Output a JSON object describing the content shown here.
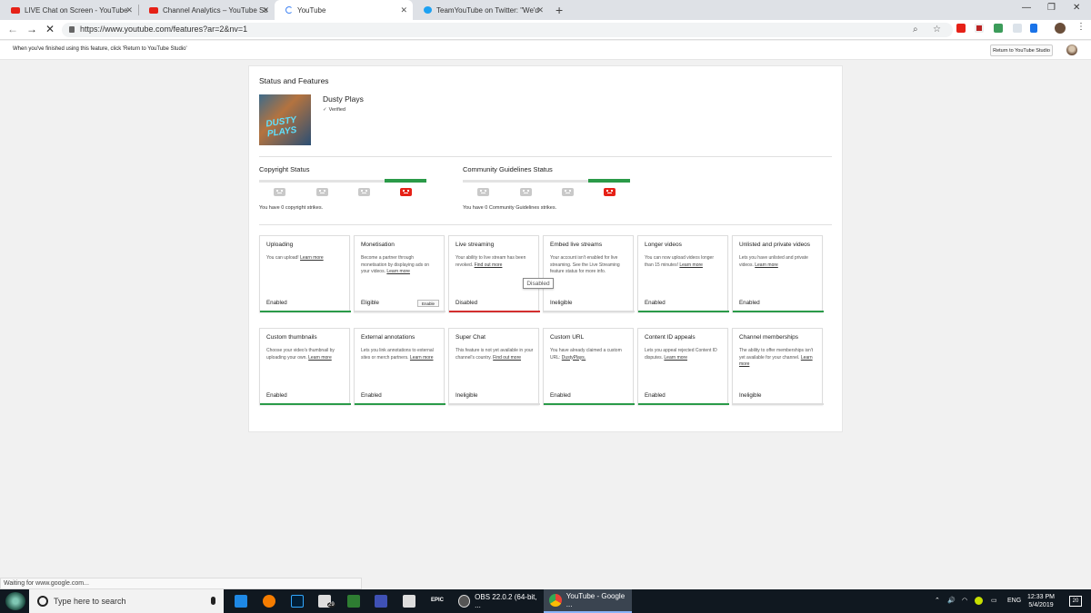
{
  "browser": {
    "tabs": [
      {
        "title": "LIVE Chat on Screen - YouTube L",
        "favicon_color": "#e62117"
      },
      {
        "title": "Channel Analytics – YouTube Stu",
        "favicon_color": "#e62117"
      },
      {
        "title": "YouTube",
        "favicon_color": "#4285f4"
      },
      {
        "title": "TeamYouTube on Twitter: \"We'd",
        "favicon_color": "#1da1f2"
      }
    ],
    "new_tab": "+",
    "url": "https://www.youtube.com/features?ar=2&nv=1",
    "status": "Waiting for www.google.com..."
  },
  "notice": {
    "text": "When you've finished using this feature, click 'Return to YouTube Studio'",
    "return_button": "Return to YouTube Studio"
  },
  "page": {
    "title": "Status and Features",
    "channel": {
      "name": "Dusty Plays",
      "verified": "Verified",
      "thumb_text": "DUSTY PLAYS"
    },
    "copyright": {
      "title": "Copyright Status",
      "text": "You have 0 copyright strikes."
    },
    "community": {
      "title": "Community Guidelines Status",
      "text": "You have 0 Community Guidelines strikes."
    },
    "features": [
      {
        "name": "Uploading",
        "desc": "You can upload!",
        "link": "Learn more",
        "state": "Enabled",
        "color": "#2a9a48"
      },
      {
        "name": "Monetisation",
        "desc": "Become a partner through monetisation by displaying ads on your videos.",
        "link": "Learn more",
        "state": "Eligible",
        "color": "#dddddd",
        "button": "Enable"
      },
      {
        "name": "Live streaming",
        "desc": "Your ability to live stream has been revoked.",
        "link": "Find out more",
        "state": "Disabled",
        "color": "#d32f2f"
      },
      {
        "name": "Embed live streams",
        "desc": "Your account isn't enabled for live streaming. See the Live Streaming feature status for more info.",
        "link": "",
        "state": "Ineligible",
        "color": "#dddddd"
      },
      {
        "name": "Longer videos",
        "desc": "You can now upload videos longer than 15 minutes!",
        "link": "Learn more",
        "state": "Enabled",
        "color": "#2a9a48"
      },
      {
        "name": "Unlisted and private videos",
        "desc": "Lets you have unlisted and private videos.",
        "link": "Learn more",
        "state": "Enabled",
        "color": "#2a9a48"
      },
      {
        "name": "Custom thumbnails",
        "desc": "Choose your video's thumbnail by uploading your own.",
        "link": "Learn more",
        "state": "Enabled",
        "color": "#2a9a48"
      },
      {
        "name": "External annotations",
        "desc": "Lets you link annotations to external sites or merch partners.",
        "link": "Learn more",
        "state": "Enabled",
        "color": "#2a9a48"
      },
      {
        "name": "Super Chat",
        "desc": "This feature is not yet available in your channel's country.",
        "link": "Find out more",
        "state": "Ineligible",
        "color": "#dddddd"
      },
      {
        "name": "Custom URL",
        "desc": "You have already claimed a custom URL:",
        "link": "DustyPlays.",
        "state": "Enabled",
        "color": "#2a9a48"
      },
      {
        "name": "Content ID appeals",
        "desc": "Lets you appeal rejected Content ID disputes.",
        "link": "Learn more",
        "state": "Enabled",
        "color": "#2a9a48"
      },
      {
        "name": "Channel memberships",
        "desc": "The ability to offer memberships isn't yet available for your channel.",
        "link": "Learn more",
        "state": "Ineligible",
        "color": "#dddddd"
      }
    ],
    "tooltip": "Disabled"
  },
  "taskbar": {
    "search_placeholder": "Type here to search",
    "apps": [
      {
        "label": "OBS 22.0.2 (64-bit, ...",
        "color": "#333333"
      },
      {
        "label": "YouTube - Google ...",
        "color": "#4285f4"
      }
    ],
    "mail_badge": "29",
    "epic": "EPIC",
    "language": "ENG",
    "time": "12:33 PM",
    "date": "5/4/2019",
    "notifications": "20"
  }
}
